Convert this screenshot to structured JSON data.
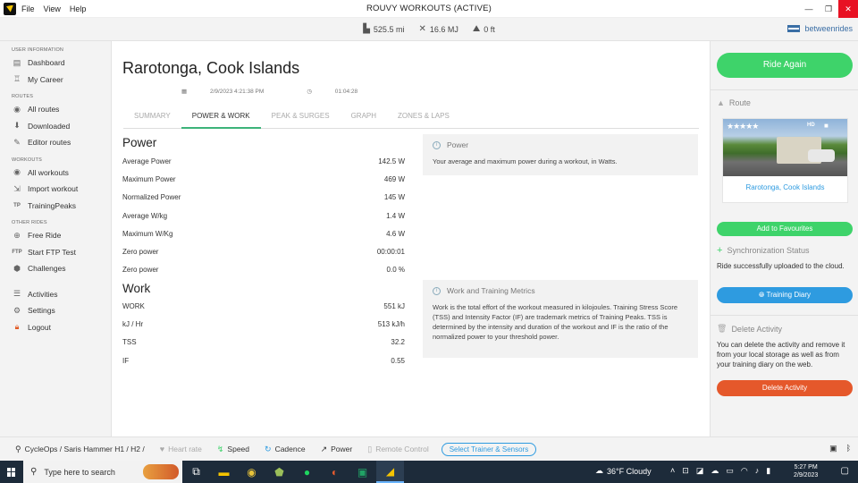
{
  "titlebar": {
    "menu": [
      "File",
      "View",
      "Help"
    ],
    "title": "ROUVY WORKOUTS (ACTIVE)",
    "controls": {
      "minimize": "—",
      "restore": "❐",
      "close": "✕"
    }
  },
  "stats": {
    "distance": "525.5 mi",
    "energy": "16.6 MJ",
    "elevation": "0 ft",
    "account": "betweenrides"
  },
  "sidebar": {
    "sections": [
      {
        "label": "USER INFORMATION",
        "items": [
          {
            "label": "Dashboard",
            "icon": "dashboard-icon"
          },
          {
            "label": "My Career",
            "icon": "career-icon"
          }
        ]
      },
      {
        "label": "ROUTES",
        "items": [
          {
            "label": "All routes",
            "icon": "eye-icon"
          },
          {
            "label": "Downloaded",
            "icon": "download-icon"
          },
          {
            "label": "Editor routes",
            "icon": "editor-icon"
          }
        ]
      },
      {
        "label": "WORKOUTS",
        "items": [
          {
            "label": "All workouts",
            "icon": "eye-icon"
          },
          {
            "label": "Import workout",
            "icon": "import-icon"
          },
          {
            "label": "TrainingPeaks",
            "icon": "trainingpeaks-icon"
          }
        ]
      },
      {
        "label": "OTHER RIDES",
        "items": [
          {
            "label": "Free Ride",
            "icon": "free-ride-icon"
          },
          {
            "label": "Start FTP Test",
            "icon": "ftp-icon"
          },
          {
            "label": "Challenges",
            "icon": "challenges-icon"
          }
        ]
      },
      {
        "label": "",
        "items": [
          {
            "label": "Activities",
            "icon": "activities-icon"
          },
          {
            "label": "Settings",
            "icon": "gear-icon"
          },
          {
            "label": "Logout",
            "icon": "lock-icon"
          }
        ]
      }
    ]
  },
  "main": {
    "title": "Rarotonga, Cook Islands",
    "date": "2/9/2023 4:21:38 PM",
    "duration": "01:04:28",
    "tabs": [
      {
        "label": "SUMMARY",
        "active": false
      },
      {
        "label": "POWER & WORK",
        "active": true
      },
      {
        "label": "PEAK & SURGES",
        "active": false
      },
      {
        "label": "GRAPH",
        "active": false
      },
      {
        "label": "ZONES & LAPS",
        "active": false
      }
    ],
    "power": {
      "heading": "Power",
      "rows": [
        {
          "label": "Average Power",
          "value": "142.5 W"
        },
        {
          "label": "Maximum Power",
          "value": "469 W"
        },
        {
          "label": "Normalized Power",
          "value": "145 W"
        },
        {
          "label": "Average W/kg",
          "value": "1.4 W"
        },
        {
          "label": "Maximum W/Kg",
          "value": "4.6 W"
        },
        {
          "label": "Zero power",
          "value": "00:00:01"
        },
        {
          "label": "Zero power",
          "value": "0.0 %"
        }
      ]
    },
    "work": {
      "heading": "Work",
      "rows": [
        {
          "label": "WORK",
          "value": "551 kJ"
        },
        {
          "label": "kJ / Hr",
          "value": "513 kJ/h"
        },
        {
          "label": "TSS",
          "value": "32.2"
        },
        {
          "label": "IF",
          "value": "0.55"
        }
      ]
    },
    "info_power": {
      "title": "Power",
      "text": "Your average and maximum power during a workout, in Watts."
    },
    "info_work": {
      "title": "Work and Training Metrics",
      "text": "Work is the total effort of the workout measured in kilojoules. Training Stress Score (TSS) and Intensity Factor (IF) are trademark metrics of Training Peaks. TSS is determined by the intensity and duration of the workout and IF is the ratio of the normalized power to your threshold power."
    }
  },
  "right": {
    "ride_again": "Ride Again",
    "route_heading": "Route",
    "route_hd": "HD",
    "route_name": "Rarotonga, Cook Islands",
    "add_favourites": "Add to Favourites",
    "sync_heading": "Synchronization Status",
    "sync_text": "Ride successfully uploaded to the cloud.",
    "training_diary": "Training Diary",
    "delete_heading": "Delete Activity",
    "delete_text": "You can delete the activity and remove it from your local storage as well as from your training diary on the web.",
    "delete_button": "Delete Activity"
  },
  "bottombar": {
    "trainer": "CycleOps / Saris Hammer H1 / H2 /",
    "sensors": [
      {
        "label": "Heart rate",
        "active": false
      },
      {
        "label": "Speed",
        "active": true
      },
      {
        "label": "Cadence",
        "active": true
      },
      {
        "label": "Power",
        "active": true
      },
      {
        "label": "Remote Control",
        "active": false
      }
    ],
    "select_button": "Select Trainer & Sensors"
  },
  "taskbar": {
    "search_placeholder": "Type here to search",
    "weather": "36°F  Cloudy",
    "time": "5:27 PM",
    "date": "2/9/2023"
  },
  "colors": {
    "accent_green": "#3ed36a",
    "accent_blue": "#2e9be0",
    "danger_orange": "#e5582b",
    "tab_underline": "#3cb37a"
  }
}
